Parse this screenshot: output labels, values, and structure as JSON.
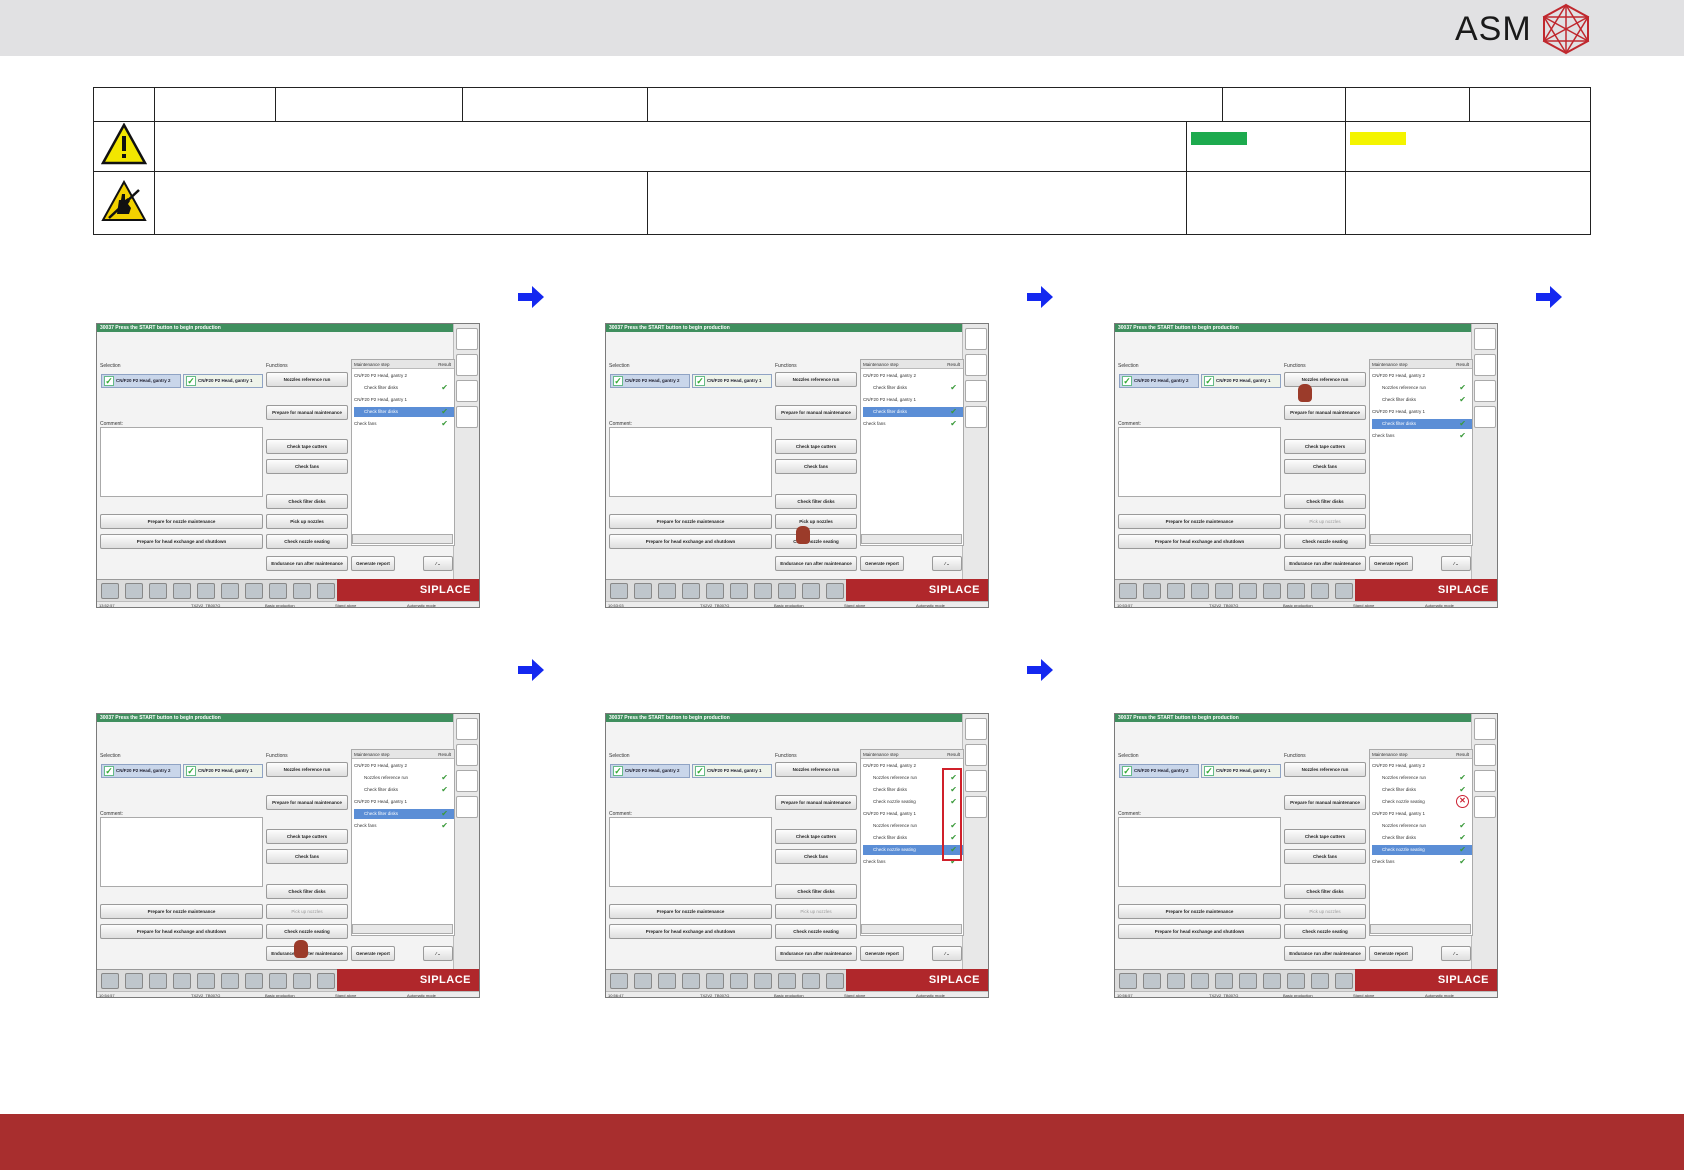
{
  "brand": {
    "logo_text": "ASM"
  },
  "colors": {
    "topbar": "#e1e1e3",
    "bottombar": "#a82e2e",
    "green_swatch": "#1daa4e",
    "yellow_swatch": "#f4f400",
    "arrow": "#1428f0"
  },
  "info_table": {
    "warning_icon": "warning-triangle-icon",
    "esd_icon": "esd-hand-icon"
  },
  "screenshots": [
    {
      "title": "30037 Press the START button to begin production",
      "selection_label": "Selection",
      "tabs": [
        "CN/F20 P2 Head, gantry 2",
        "CN/F20 P2 Head, gantry 1"
      ],
      "comment_label": "Comment:",
      "functions_label": "Functions",
      "buttons": {
        "nozzle_ref": "Nozzles reference run",
        "prepare_manual": "Prepare for manual maintenance",
        "tape_cutters": "Check tape cutters",
        "fans": "Check fans",
        "filter_disks": "Check filter disks",
        "pick_up": "Pick up nozzles",
        "nozzle_seating": "Check nozzle seating",
        "endurance": "Endurance run after maintenance",
        "report": "Generate report",
        "prep_nozzle": "Prepare for nozzle maintenance",
        "prep_head": "Prepare for head exchange and shutdown"
      },
      "panel_header": "Maintenance step",
      "result_header": "Result",
      "steps": [
        {
          "text": "CN/F20 P2 Head, gantry 2",
          "indent": false,
          "result": ""
        },
        {
          "text": "Check filter disks",
          "indent": true,
          "result": "ok"
        },
        {
          "text": "CN/F20 P2 Head, gantry 1",
          "indent": false,
          "result": ""
        },
        {
          "text": "Check filter disks",
          "indent": true,
          "result": "ok",
          "selected": true
        },
        {
          "text": "Check fans",
          "indent": false,
          "result": "ok"
        }
      ],
      "status": {
        "time": "13:52:57",
        "machine": "TX2V2_TB007G",
        "mode1": "Basic production",
        "mode2": "Stand alone",
        "mode3": "Automatic mode"
      },
      "siplace": "SIPLACE",
      "pickup_disabled": false
    },
    {
      "title": "30037 Press the START button to begin production",
      "selection_label": "Selection",
      "tabs": [
        "CN/F20 P2 Head, gantry 2",
        "CN/F20 P2 Head, gantry 1"
      ],
      "comment_label": "Comment:",
      "functions_label": "Functions",
      "buttons": {
        "nozzle_ref": "Nozzles reference run",
        "prepare_manual": "Prepare for manual maintenance",
        "tape_cutters": "Check tape cutters",
        "fans": "Check fans",
        "filter_disks": "Check filter disks",
        "pick_up": "Pick up nozzles",
        "nozzle_seating": "Check nozzle seating",
        "endurance": "Endurance run after maintenance",
        "report": "Generate report",
        "prep_nozzle": "Prepare for nozzle maintenance",
        "prep_head": "Prepare for head exchange and shutdown"
      },
      "panel_header": "Maintenance step",
      "result_header": "Result",
      "steps": [
        {
          "text": "CN/F20 P2 Head, gantry 2",
          "indent": false,
          "result": ""
        },
        {
          "text": "Check filter disks",
          "indent": true,
          "result": "ok"
        },
        {
          "text": "CN/F20 P2 Head, gantry 1",
          "indent": false,
          "result": ""
        },
        {
          "text": "Check filter disks",
          "indent": true,
          "result": "ok",
          "selected": true
        },
        {
          "text": "Check fans",
          "indent": false,
          "result": "ok"
        }
      ],
      "status": {
        "time": "10:53:03",
        "machine": "TX2V2_TB007G",
        "mode1": "Basic production",
        "mode2": "Stand alone",
        "mode3": "Automatic mode"
      },
      "siplace": "SIPLACE",
      "pickup_disabled": false
    },
    {
      "title": "30037 Press the START button to begin production",
      "selection_label": "Selection",
      "tabs": [
        "CN/F20 P2 Head, gantry 2",
        "CN/F20 P2 Head, gantry 1"
      ],
      "comment_label": "Comment:",
      "functions_label": "Functions",
      "buttons": {
        "nozzle_ref": "Nozzles reference run",
        "prepare_manual": "Prepare for manual maintenance",
        "tape_cutters": "Check tape cutters",
        "fans": "Check fans",
        "filter_disks": "Check filter disks",
        "pick_up": "Pick up nozzles",
        "nozzle_seating": "Check nozzle seating",
        "endurance": "Endurance run after maintenance",
        "report": "Generate report",
        "prep_nozzle": "Prepare for nozzle maintenance",
        "prep_head": "Prepare for head exchange and shutdown"
      },
      "panel_header": "Maintenance step",
      "result_header": "Result",
      "steps": [
        {
          "text": "CN/F20 P2 Head, gantry 2",
          "indent": false,
          "result": ""
        },
        {
          "text": "Nozzles reference run",
          "indent": true,
          "result": "ok"
        },
        {
          "text": "Check filter disks",
          "indent": true,
          "result": "ok"
        },
        {
          "text": "CN/F20 P2 Head, gantry 1",
          "indent": false,
          "result": ""
        },
        {
          "text": "Check filter disks",
          "indent": true,
          "result": "ok",
          "selected": true
        },
        {
          "text": "Check fans",
          "indent": false,
          "result": "ok"
        }
      ],
      "status": {
        "time": "10:53:57",
        "machine": "TX2V2_TB007G",
        "mode1": "Basic production",
        "mode2": "Stand alone",
        "mode3": "Automatic mode"
      },
      "siplace": "SIPLACE",
      "pickup_disabled": true
    },
    {
      "title": "30037 Press the START button to begin production",
      "selection_label": "Selection",
      "tabs": [
        "CN/F20 P2 Head, gantry 2",
        "CN/F20 P2 Head, gantry 1"
      ],
      "comment_label": "Comment:",
      "functions_label": "Functions",
      "buttons": {
        "nozzle_ref": "Nozzles reference run",
        "prepare_manual": "Prepare for manual maintenance",
        "tape_cutters": "Check tape cutters",
        "fans": "Check fans",
        "filter_disks": "Check filter disks",
        "pick_up": "Pick up nozzles",
        "nozzle_seating": "Check nozzle seating",
        "endurance": "Endurance run after maintenance",
        "report": "Generate report",
        "prep_nozzle": "Prepare for nozzle maintenance",
        "prep_head": "Prepare for head exchange and shutdown"
      },
      "panel_header": "Maintenance step",
      "result_header": "Result",
      "steps": [
        {
          "text": "CN/F20 P2 Head, gantry 2",
          "indent": false,
          "result": ""
        },
        {
          "text": "Nozzles reference run",
          "indent": true,
          "result": "ok"
        },
        {
          "text": "Check filter disks",
          "indent": true,
          "result": "ok"
        },
        {
          "text": "CN/F20 P2 Head, gantry 1",
          "indent": false,
          "result": ""
        },
        {
          "text": "Check filter disks",
          "indent": true,
          "result": "ok",
          "selected": true
        },
        {
          "text": "Check fans",
          "indent": false,
          "result": "ok"
        }
      ],
      "status": {
        "time": "10:54:57",
        "machine": "TX2V2_TB007G",
        "mode1": "Basic production",
        "mode2": "Stand alone",
        "mode3": "Automatic mode"
      },
      "siplace": "SIPLACE",
      "pickup_disabled": true
    },
    {
      "title": "30037 Press the START button to begin production",
      "selection_label": "Selection",
      "tabs": [
        "CN/F20 P2 Head, gantry 2",
        "CN/F20 P2 Head, gantry 1"
      ],
      "comment_label": "Comment:",
      "functions_label": "Functions",
      "buttons": {
        "nozzle_ref": "Nozzles reference run",
        "prepare_manual": "Prepare for manual maintenance",
        "tape_cutters": "Check tape cutters",
        "fans": "Check fans",
        "filter_disks": "Check filter disks",
        "pick_up": "Pick up nozzles",
        "nozzle_seating": "Check nozzle seating",
        "endurance": "Endurance run after maintenance",
        "report": "Generate report",
        "prep_nozzle": "Prepare for nozzle maintenance",
        "prep_head": "Prepare for head exchange and shutdown"
      },
      "panel_header": "Maintenance step",
      "result_header": "Result",
      "steps": [
        {
          "text": "CN/F20 P2 Head, gantry 2",
          "indent": false,
          "result": ""
        },
        {
          "text": "Nozzles reference run",
          "indent": true,
          "result": "ok"
        },
        {
          "text": "Check filter disks",
          "indent": true,
          "result": "ok"
        },
        {
          "text": "Check nozzle seating",
          "indent": true,
          "result": "ok"
        },
        {
          "text": "CN/F20 P2 Head, gantry 1",
          "indent": false,
          "result": ""
        },
        {
          "text": "Nozzles reference run",
          "indent": true,
          "result": "ok"
        },
        {
          "text": "Check filter disks",
          "indent": true,
          "result": "ok"
        },
        {
          "text": "Check nozzle seating",
          "indent": true,
          "result": "ok",
          "selected": true
        },
        {
          "text": "Check fans",
          "indent": false,
          "result": "ok"
        }
      ],
      "status": {
        "time": "10:56:47",
        "machine": "TX2V2_TB007G",
        "mode1": "Basic production",
        "mode2": "Stand alone",
        "mode3": "Automatic mode"
      },
      "siplace": "SIPLACE",
      "pickup_disabled": true,
      "highlight_results": true
    },
    {
      "title": "30037 Press the START button to begin production",
      "selection_label": "Selection",
      "tabs": [
        "CN/F20 P2 Head, gantry 2",
        "CN/F20 P2 Head, gantry 1"
      ],
      "comment_label": "Comment:",
      "functions_label": "Functions",
      "buttons": {
        "nozzle_ref": "Nozzles reference run",
        "prepare_manual": "Prepare for manual maintenance",
        "tape_cutters": "Check tape cutters",
        "fans": "Check fans",
        "filter_disks": "Check filter disks",
        "pick_up": "Pick up nozzles",
        "nozzle_seating": "Check nozzle seating",
        "endurance": "Endurance run after maintenance",
        "report": "Generate report",
        "prep_nozzle": "Prepare for nozzle maintenance",
        "prep_head": "Prepare for head exchange and shutdown"
      },
      "panel_header": "Maintenance step",
      "result_header": "Result",
      "steps": [
        {
          "text": "CN/F20 P2 Head, gantry 2",
          "indent": false,
          "result": ""
        },
        {
          "text": "Nozzles reference run",
          "indent": true,
          "result": "ok"
        },
        {
          "text": "Check filter disks",
          "indent": true,
          "result": "ok"
        },
        {
          "text": "Check nozzle seating",
          "indent": true,
          "result": "fail"
        },
        {
          "text": "CN/F20 P2 Head, gantry 1",
          "indent": false,
          "result": ""
        },
        {
          "text": "Nozzles reference run",
          "indent": true,
          "result": "ok"
        },
        {
          "text": "Check filter disks",
          "indent": true,
          "result": "ok"
        },
        {
          "text": "Check nozzle seating",
          "indent": true,
          "result": "ok",
          "selected": true
        },
        {
          "text": "Check fans",
          "indent": false,
          "result": "ok"
        }
      ],
      "status": {
        "time": "10:56:57",
        "machine": "TX2V2_TB007G",
        "mode1": "Basic production",
        "mode2": "Stand alone",
        "mode3": "Automatic mode"
      },
      "siplace": "SIPLACE",
      "pickup_disabled": true
    }
  ]
}
